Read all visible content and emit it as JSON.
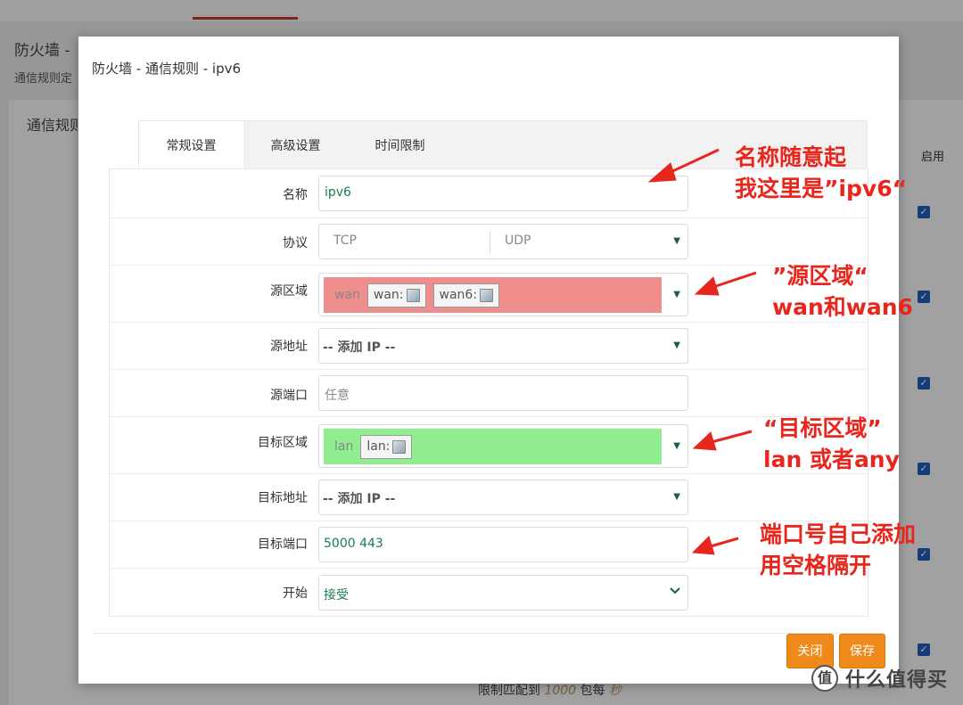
{
  "background": {
    "page_title": "防火墙 -",
    "subtitle": "通信规则定",
    "panel_title": "通信规则",
    "enable_header": "启用",
    "footer_prefix": "限制匹配到",
    "footer_value": "1000",
    "footer_mid": "包每",
    "footer_unit": "秒"
  },
  "modal": {
    "title": "防火墙 - 通信规则 - ipv6",
    "tabs": [
      "常规设置",
      "高级设置",
      "时间限制"
    ],
    "fields": {
      "name": {
        "label": "名称",
        "value": "ipv6"
      },
      "protocol": {
        "label": "协议",
        "options": [
          "TCP",
          "UDP"
        ]
      },
      "src_zone": {
        "label": "源区域",
        "zone_text": "wan",
        "pills": [
          "wan:",
          "wan6:"
        ],
        "color": "#f08d8d"
      },
      "src_addr": {
        "label": "源地址",
        "placeholder": "-- 添加 IP --"
      },
      "src_port": {
        "label": "源端口",
        "placeholder": "任意"
      },
      "dst_zone": {
        "label": "目标区域",
        "zone_text": "lan",
        "pills": [
          "lan:"
        ],
        "color": "#90ee90"
      },
      "dst_addr": {
        "label": "目标地址",
        "placeholder": "-- 添加 IP --"
      },
      "dst_port": {
        "label": "目标端口",
        "value": "5000 443"
      },
      "action": {
        "label": "开始",
        "value": "接受"
      }
    },
    "buttons": {
      "close": "关闭",
      "save": "保存"
    }
  },
  "annotations": {
    "a1": [
      "名称随意起",
      "我这里是”ipv6“"
    ],
    "a2": [
      "”源区域“",
      "wan和wan6"
    ],
    "a3": [
      "“目标区域”",
      "lan 或者any"
    ],
    "a4": [
      "端口号自己添加",
      "用空格隔开"
    ]
  },
  "watermark": {
    "logo": "值",
    "text": "什么值得买"
  },
  "colors": {
    "accent": "#ef8a1a",
    "annotation": "#e8261d",
    "value": "#1a7d4b"
  }
}
